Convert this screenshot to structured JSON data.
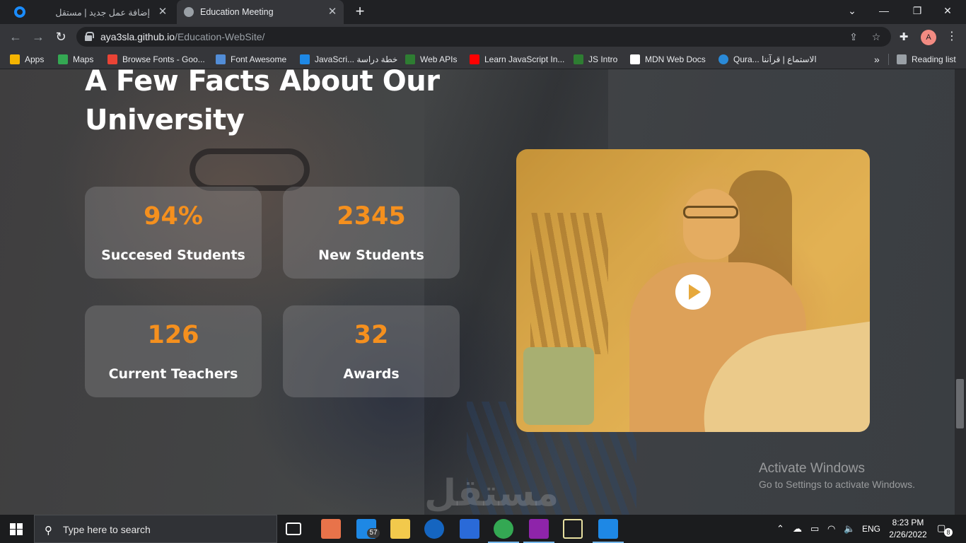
{
  "browser": {
    "tabs": [
      {
        "title": "إضافة عمل جديد | مستقل",
        "active": false
      },
      {
        "title": "Education Meeting",
        "active": true
      }
    ],
    "url_host": "aya3sla.github.io",
    "url_path": "/Education-WebSite/",
    "profile_initial": "A",
    "bookmarks": [
      {
        "label": "Apps",
        "icon": "apps-grid-icon",
        "color": "#f4b400"
      },
      {
        "label": "Maps",
        "icon": "maps-icon",
        "color": "#34a853"
      },
      {
        "label": "Browse Fonts - Goo...",
        "icon": "google-fonts-icon",
        "color": "#ea4335"
      },
      {
        "label": "Font Awesome",
        "icon": "font-awesome-flag-icon",
        "color": "#528dd7"
      },
      {
        "label": "JavaScri... خطة دراسة",
        "icon": "e-letter-icon",
        "color": "#1e88e5"
      },
      {
        "label": "Web APIs",
        "icon": "w3-icon",
        "color": "#2e7d32"
      },
      {
        "label": "Learn JavaScript In...",
        "icon": "youtube-icon",
        "color": "#ff0000"
      },
      {
        "label": "JS Intro",
        "icon": "w3-icon",
        "color": "#2e7d32"
      },
      {
        "label": "MDN Web Docs",
        "icon": "mdn-icon",
        "color": "#ffffff"
      },
      {
        "label": "Qura... الاستماع | قرآننا",
        "icon": "quran-icon",
        "color": "#2a8ad8"
      }
    ],
    "bookmarks_overflow": "»",
    "reading_list": "Reading list"
  },
  "page": {
    "heading_line1": "A Few Facts About Our",
    "heading_line2": "University",
    "accent_color": "#f5901e",
    "facts": [
      {
        "value": "94%",
        "label": "Succesed Students"
      },
      {
        "value": "2345",
        "label": "New Students"
      },
      {
        "value": "126",
        "label": "Current Teachers"
      },
      {
        "value": "32",
        "label": "Awards"
      }
    ],
    "video_play_icon": "play-icon"
  },
  "overlay": {
    "activate_title": "Activate Windows",
    "activate_sub": "Go to Settings to activate Windows.",
    "watermark": "مستقل"
  },
  "taskbar": {
    "search_placeholder": "Type here to search",
    "mail_badge": "57",
    "language": "ENG",
    "time": "8:23 PM",
    "date": "2/26/2022",
    "notifications": "8"
  }
}
